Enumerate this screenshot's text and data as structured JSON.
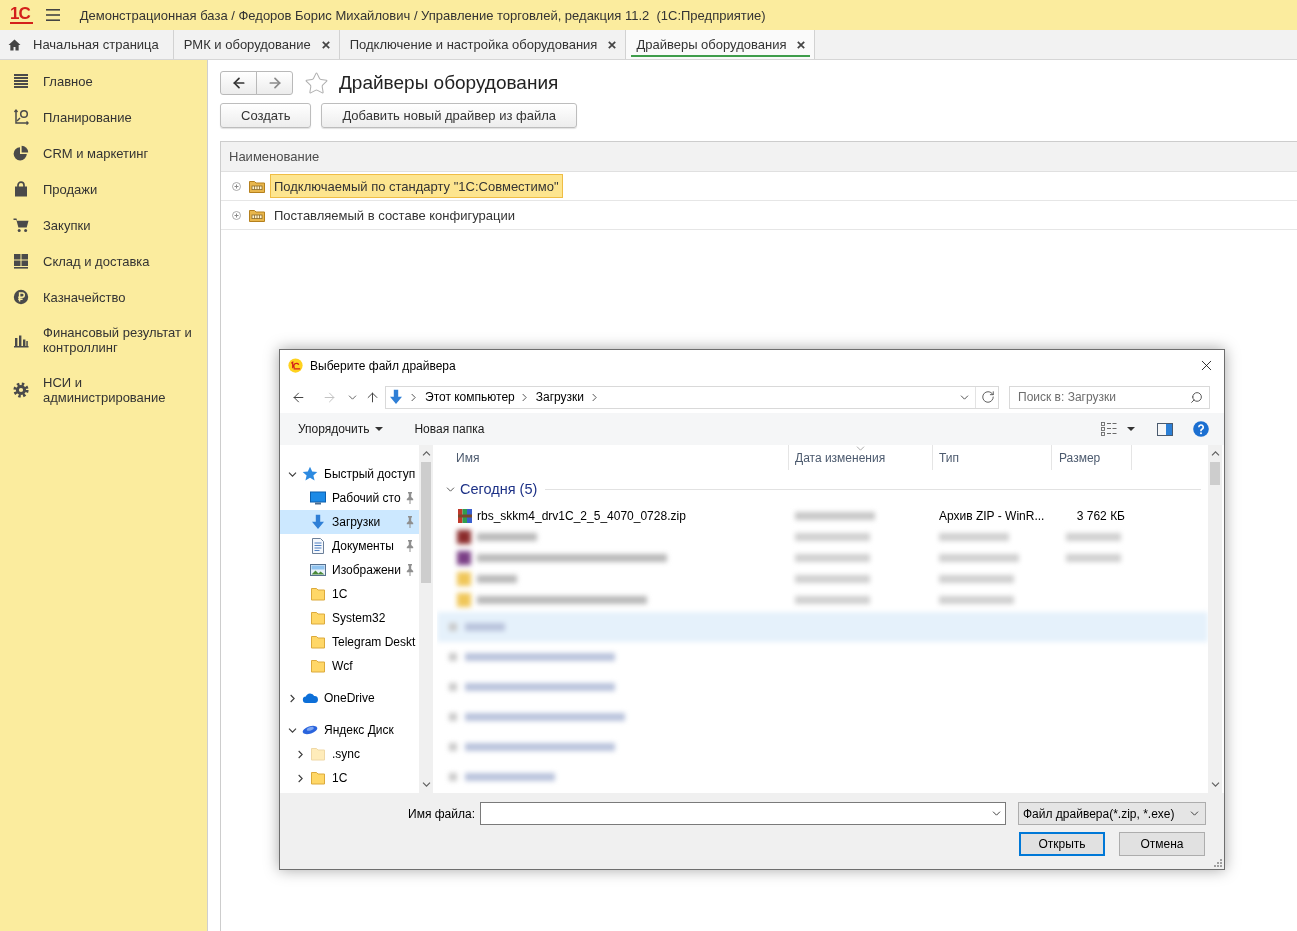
{
  "app_bar": {
    "logo": "1С",
    "title": "Демонстрационная база / Федоров Борис Михайлович / Управление торговлей, редакция 11.2  (1С:Предприятие)"
  },
  "tabs": [
    {
      "kind": "home",
      "label": "Начальная страница",
      "selected": false
    },
    {
      "kind": "page",
      "label": "РМК и оборудование",
      "selected": false
    },
    {
      "kind": "page",
      "label": "Подключение и настройка оборудования",
      "selected": false
    },
    {
      "kind": "page",
      "label": "Драйверы оборудования",
      "selected": true
    }
  ],
  "sidebar": {
    "items": [
      {
        "label": "Главное"
      },
      {
        "label": "Планирование"
      },
      {
        "label": "CRM и маркетинг"
      },
      {
        "label": "Продажи"
      },
      {
        "label": "Закупки"
      },
      {
        "label": "Склад и доставка"
      },
      {
        "label": "Казначейство"
      },
      {
        "label": "Финансовый результат и контроллинг"
      },
      {
        "label": "НСИ и администрирование"
      }
    ]
  },
  "page": {
    "title": "Драйверы оборудования",
    "favorite": false,
    "buttons": [
      "Создать",
      "Добавить новый драйвер из файла"
    ],
    "table": {
      "columns": [
        "Наименование"
      ],
      "rows": [
        {
          "name": "Подключаемый по стандарту \"1С:Совместимо\"",
          "expanded": false,
          "selected": true
        },
        {
          "name": "Поставляемый в составе конфигурации",
          "expanded": false,
          "selected": false
        }
      ]
    }
  },
  "dialog": {
    "title": "Выберите файл драйвера",
    "address": {
      "path": [
        "Этот компьютер",
        "Загрузки"
      ]
    },
    "search": {
      "placeholder": "Поиск в: Загрузки"
    },
    "toolbar": {
      "organize": "Упорядочить",
      "new_folder": "Новая папка"
    },
    "nav": [
      {
        "kind": "quick",
        "label": "Быстрый доступ",
        "expanded": true,
        "selected": false,
        "children": [
          {
            "kind": "desktop",
            "label": "Рабочий сто",
            "pinned": true,
            "selected": false
          },
          {
            "kind": "downloads",
            "label": "Загрузки",
            "pinned": true,
            "selected": true
          },
          {
            "kind": "documents",
            "label": "Документы",
            "pinned": true,
            "selected": false
          },
          {
            "kind": "pictures",
            "label": "Изображени",
            "pinned": true,
            "selected": false
          },
          {
            "kind": "folder",
            "label": "1C",
            "pinned": false,
            "selected": false
          },
          {
            "kind": "folder",
            "label": "System32",
            "pinned": false,
            "selected": false
          },
          {
            "kind": "folder",
            "label": "Telegram Deskt",
            "pinned": false,
            "selected": false
          },
          {
            "kind": "folder",
            "label": "Wcf",
            "pinned": false,
            "selected": false
          }
        ]
      },
      {
        "kind": "cloud",
        "label": "OneDrive",
        "expanded": false,
        "selected": false
      },
      {
        "kind": "disk",
        "label": "Яндекс Диск",
        "expanded": true,
        "selected": false,
        "children": [
          {
            "kind": "folder",
            "label": ".sync",
            "hidden": true,
            "expanded": false,
            "selected": false
          },
          {
            "kind": "folder",
            "label": "1C",
            "hidden": false,
            "expanded": false,
            "selected": false
          }
        ]
      }
    ],
    "columns": [
      {
        "label": "Имя",
        "sorted": false
      },
      {
        "label": "Дата изменения",
        "sorted": true
      },
      {
        "label": "Тип",
        "sorted": false
      },
      {
        "label": "Размер",
        "sorted": false
      }
    ],
    "groups": [
      {
        "label": "Сегодня (5)",
        "expanded": true,
        "files": [
          {
            "name": "rbs_skkm4_drv1C_2_5_4070_0728.zip",
            "type": "Архив ZIP - WinR...",
            "size": "3 762 КБ"
          }
        ]
      }
    ],
    "file_name": {
      "label": "Имя файла:"
    },
    "filter": "Файл драйвера(*.zip, *.exe)",
    "buttons": [
      {
        "label": "Открыть",
        "default": true
      },
      {
        "label": "Отмена",
        "default": false
      }
    ]
  }
}
